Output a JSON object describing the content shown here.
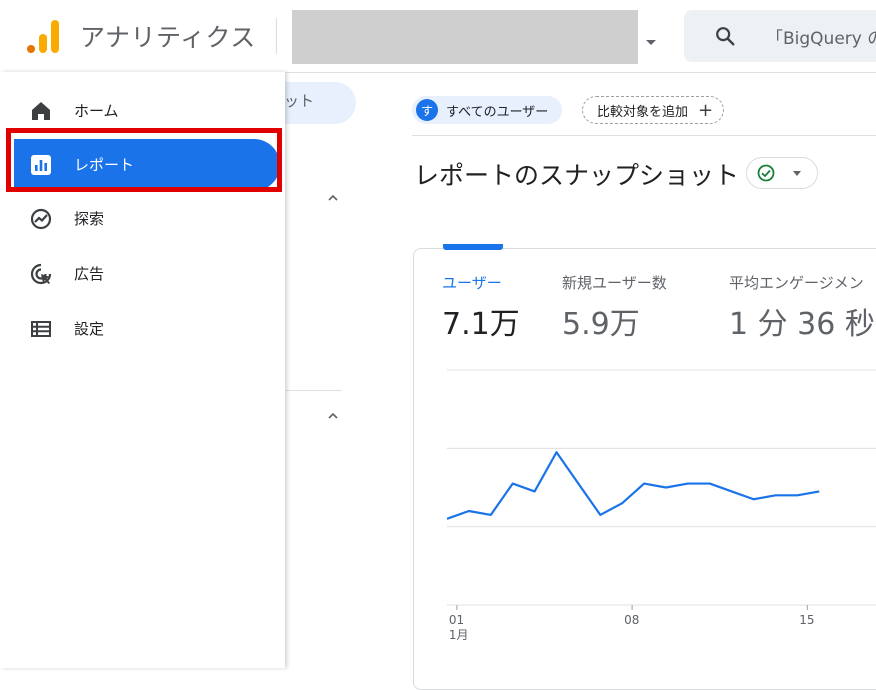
{
  "app": {
    "title": "アナリティクス"
  },
  "search": {
    "placeholder": "「BigQuery の"
  },
  "background": {
    "pill_text": "ット"
  },
  "sidebar": {
    "items": [
      {
        "label": "ホーム",
        "icon": "home-icon"
      },
      {
        "label": "レポート",
        "icon": "bar-chart-icon"
      },
      {
        "label": "探索",
        "icon": "explore-icon"
      },
      {
        "label": "広告",
        "icon": "ads-icon"
      },
      {
        "label": "設定",
        "icon": "list-icon"
      }
    ]
  },
  "filters": {
    "user_badge": "す",
    "user_chip": "すべてのユーザー",
    "add_compare": "比較対象を追加"
  },
  "page": {
    "title": "レポートのスナップショット"
  },
  "metrics": [
    {
      "label": "ユーザー",
      "value": "7.1万"
    },
    {
      "label": "新規ユーザー数",
      "value": "5.9万"
    },
    {
      "label": "平均エンゲージメン",
      "value": "1 分 36 秒"
    }
  ],
  "colors": {
    "accent": "#1a73e8",
    "highlight": "#e00000",
    "status_ok": "#188038"
  },
  "chart_data": {
    "type": "line",
    "x_ticks": [
      {
        "label": "01",
        "sub": "1月"
      },
      {
        "label": "08",
        "sub": ""
      },
      {
        "label": "15",
        "sub": ""
      }
    ],
    "series": [
      {
        "values": [
          62,
          64,
          63,
          71,
          69,
          79,
          71,
          63,
          66,
          71,
          70,
          71,
          71,
          69,
          67,
          68,
          68,
          69
        ]
      }
    ],
    "ylim": [
      40,
      100
    ],
    "grid": true
  }
}
